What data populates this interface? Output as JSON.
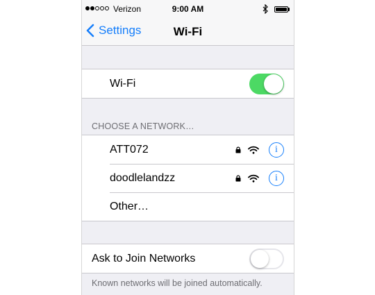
{
  "status_bar": {
    "signal_dots_filled": 2,
    "signal_dots_total": 5,
    "carrier": "Verizon",
    "time": "9:00 AM",
    "bluetooth_icon": "bluetooth-icon",
    "battery_icon": "battery-icon"
  },
  "nav": {
    "back_label": "Settings",
    "back_icon": "chevron-left-icon",
    "title": "Wi-Fi"
  },
  "wifi_toggle": {
    "label": "Wi-Fi",
    "on": true
  },
  "networks": {
    "section_header": "CHOOSE A NETWORK…",
    "items": [
      {
        "name": "ATT072",
        "locked": true,
        "info_glyph": "i"
      },
      {
        "name": "doodlelandzz",
        "locked": true,
        "info_glyph": "i"
      }
    ],
    "other_label": "Other…"
  },
  "ask_to_join": {
    "label": "Ask to Join Networks",
    "on": false,
    "footer": "Known networks will be joined automatically."
  },
  "colors": {
    "accent": "#157efb",
    "toggle_on": "#4cd964",
    "background": "#efeff4"
  }
}
